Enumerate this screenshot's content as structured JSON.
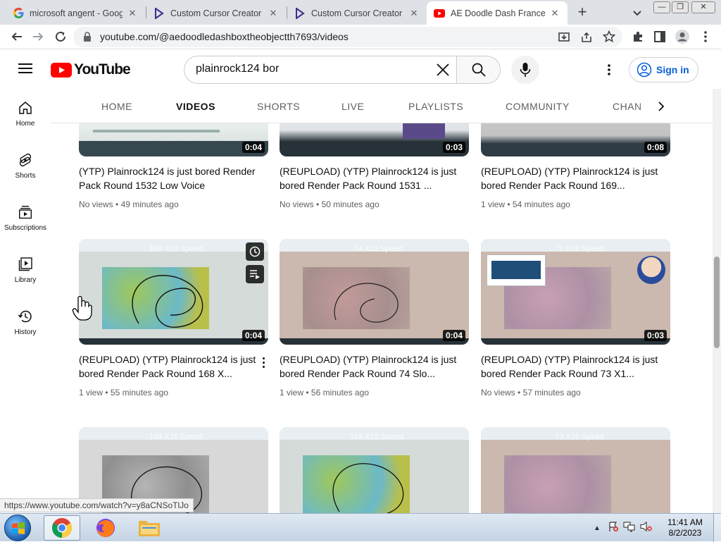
{
  "browser": {
    "tabs": [
      {
        "title": "microsoft angent - Goog",
        "icon": "google-icon",
        "active": false
      },
      {
        "title": "Custom Cursor Creator - ",
        "icon": "custom-cursor-icon",
        "active": false
      },
      {
        "title": "Custom Cursor Creator - ",
        "icon": "custom-cursor-icon",
        "active": false
      },
      {
        "title": "AE Doodle Dash France T",
        "icon": "youtube-icon",
        "active": true
      }
    ],
    "url": "youtube.com/@aedoodledashboxtheobjectth7693/videos",
    "status_url": "https://www.youtube.com/watch?v=y8aCNSoTlJo"
  },
  "youtube": {
    "logo_text": "YouTube",
    "search_value": "plainrock124 bor",
    "sign_in_label": "Sign in",
    "guide": [
      {
        "label": "Home",
        "icon": "home-icon"
      },
      {
        "label": "Shorts",
        "icon": "shorts-icon"
      },
      {
        "label": "Subscriptions",
        "icon": "subscriptions-icon"
      },
      {
        "label": "Library",
        "icon": "library-icon"
      },
      {
        "label": "History",
        "icon": "history-icon"
      }
    ],
    "channel_tabs": [
      {
        "label": "HOME",
        "active": false
      },
      {
        "label": "VIDEOS",
        "active": true
      },
      {
        "label": "SHORTS",
        "active": false
      },
      {
        "label": "LIVE",
        "active": false
      },
      {
        "label": "PLAYLISTS",
        "active": false
      },
      {
        "label": "COMMUNITY",
        "active": false
      },
      {
        "label": "CHAN",
        "active": false
      }
    ],
    "videos": [
      {
        "title": "(YTP) Plainrock124 is just bored Render Pack Round 1532 Low Voice",
        "duration": "0:04",
        "views": "No views",
        "age": "49 minutes ago"
      },
      {
        "title": "(REUPLOAD) (YTP) Plainrock124 is just bored Render Pack Round 1531 ...",
        "duration": "0:03",
        "views": "No views",
        "age": "50 minutes ago"
      },
      {
        "title": "(REUPLOAD) (YTP) Plainrock124 is just bored Render Pack Round 169...",
        "duration": "0:08",
        "views": "1 view",
        "age": "54 minutes ago"
      },
      {
        "title": "(REUPLOAD) (YTP) Plainrock124 is just bored Render Pack Round 168 X...",
        "duration": "0:04",
        "views": "1 view",
        "age": "55 minutes ago"
      },
      {
        "title": "(REUPLOAD) (YTP) Plainrock124 is just bored Render Pack Round 74 Slo...",
        "duration": "0:04",
        "views": "1 view",
        "age": "56 minutes ago"
      },
      {
        "title": "(REUPLOAD) (YTP) Plainrock124 is just bored Render Pack Round 73 X1...",
        "duration": "0:03",
        "views": "No views",
        "age": "57 minutes ago"
      },
      {
        "title": "",
        "duration": "",
        "views": "",
        "age": ""
      },
      {
        "title": "",
        "duration": "",
        "views": "",
        "age": ""
      },
      {
        "title": "",
        "duration": "",
        "views": "",
        "age": ""
      }
    ],
    "thumb_overlay_texts": [
      "168 X16 Speed",
      "74 X16 Speed",
      "73 X16 Speed",
      "168 X16 Speed",
      "168 X16 Speed",
      "73 X16 Speed"
    ]
  },
  "taskbar": {
    "apps": [
      {
        "name": "chrome",
        "icon": "chrome-icon",
        "active": true
      },
      {
        "name": "firefox",
        "icon": "firefox-icon",
        "active": false
      },
      {
        "name": "explorer",
        "icon": "folder-icon",
        "active": false
      }
    ],
    "time": "11:41 AM",
    "date": "8/2/2023"
  },
  "colors": {
    "youtube_red": "#ff0000",
    "signin_blue": "#065fd4",
    "meta_grey": "#606060"
  }
}
